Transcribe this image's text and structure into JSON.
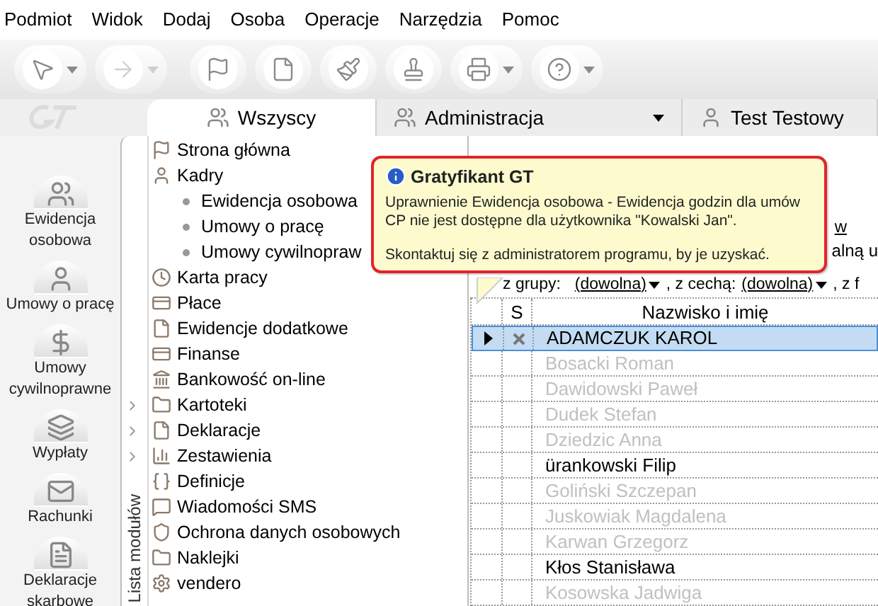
{
  "menu": [
    "Podmiot",
    "Widok",
    "Dodaj",
    "Osoba",
    "Operacje",
    "Narzędzia",
    "Pomoc"
  ],
  "toolbar": [
    {
      "kind": "arrow-left",
      "dropdown": true,
      "disabled": false
    },
    {
      "kind": "arrow-right",
      "dropdown": true,
      "disabled": true
    },
    {
      "kind": "flag",
      "dropdown": false,
      "disabled": false
    },
    {
      "kind": "sheet",
      "dropdown": false,
      "disabled": false
    },
    {
      "kind": "brush",
      "dropdown": false,
      "disabled": false
    },
    {
      "kind": "stamp",
      "dropdown": false,
      "disabled": false
    },
    {
      "kind": "printer",
      "dropdown": true,
      "disabled": false
    },
    {
      "kind": "help",
      "dropdown": true,
      "disabled": false
    }
  ],
  "tabs": [
    {
      "label": "Wszyscy",
      "kind": "group",
      "selected": true,
      "dropdown": false
    },
    {
      "label": "Administracja",
      "kind": "pair",
      "selected": false,
      "dropdown": true
    },
    {
      "label": "Test Testowy",
      "kind": "person",
      "selected": false,
      "dropdown": false
    }
  ],
  "shortcuts": [
    {
      "label": "Ewidencja osobowa",
      "kind": "people"
    },
    {
      "label": "Umowy o pracę",
      "kind": "contract"
    },
    {
      "label": "Umowy cywilnoprawne",
      "kind": "money"
    },
    {
      "label": "Wypłaty",
      "kind": "envelopes"
    },
    {
      "label": "Rachunki",
      "kind": "mail"
    },
    {
      "label": "Deklaracje skarbowe",
      "kind": "docs"
    }
  ],
  "modules_label": "Lista modułów",
  "modules": [
    {
      "label": "Strona główna",
      "kind": "flag",
      "arrow": false
    },
    {
      "label": "Kadry",
      "kind": "person",
      "arrow": false,
      "children": [
        {
          "label": "Ewidencja osobowa"
        },
        {
          "label": "Umowy o pracę"
        },
        {
          "label": "Umowy cywilnopraw"
        }
      ]
    },
    {
      "label": "Karta pracy",
      "kind": "clock",
      "arrow": false
    },
    {
      "label": "Płace",
      "kind": "cards",
      "arrow": false
    },
    {
      "label": "Ewidencje dodatkowe",
      "kind": "sheet",
      "arrow": false
    },
    {
      "label": "Finanse",
      "kind": "cards",
      "arrow": false
    },
    {
      "label": "Bankowość on-line",
      "kind": "bank",
      "arrow": false
    },
    {
      "label": "Kartoteki",
      "kind": "folder",
      "arrow": true
    },
    {
      "label": "Deklaracje",
      "kind": "sheet",
      "arrow": true
    },
    {
      "label": "Zestawienia",
      "kind": "chart",
      "arrow": true
    },
    {
      "label": "Definicje",
      "kind": "braces",
      "arrow": false
    },
    {
      "label": "Wiadomości SMS",
      "kind": "sms",
      "arrow": false
    },
    {
      "label": "Ochrona danych osobowych",
      "kind": "shield",
      "arrow": false
    },
    {
      "label": "Naklejki",
      "kind": "folder",
      "arrow": false
    },
    {
      "label": "vendero",
      "kind": "gear",
      "arrow": false
    }
  ],
  "content": {
    "link_fragment": "w",
    "text_fragment": "alną u",
    "filter": {
      "group_label": "z grupy:",
      "group_value": "(dowolna)",
      "trait_label": ", z cechą:",
      "trait_value": "(dowolna)",
      "more": ", z f"
    },
    "columns": [
      "S",
      "Nazwisko i imię"
    ],
    "rows": [
      {
        "name": "ADAMCZUK KAROL",
        "selected": true,
        "marked": true,
        "disabled": false
      },
      {
        "name": "Bosacki Roman",
        "selected": false,
        "marked": false,
        "disabled": true
      },
      {
        "name": "Dawidowski Paweł",
        "selected": false,
        "marked": false,
        "disabled": true
      },
      {
        "name": "Dudek Stefan",
        "selected": false,
        "marked": false,
        "disabled": true
      },
      {
        "name": "Dziedzic Anna",
        "selected": false,
        "marked": false,
        "disabled": true
      },
      {
        "name": "ürankowski Filip",
        "selected": false,
        "marked": false,
        "disabled": false
      },
      {
        "name": "Goliński Szczepan",
        "selected": false,
        "marked": false,
        "disabled": true
      },
      {
        "name": "Juskowiak Magdalena",
        "selected": false,
        "marked": false,
        "disabled": true
      },
      {
        "name": "Karwan Grzegorz",
        "selected": false,
        "marked": false,
        "disabled": true
      },
      {
        "name": "Kłos Stanisława",
        "selected": false,
        "marked": false,
        "disabled": false
      },
      {
        "name": "Kosowska Jadwiga",
        "selected": false,
        "marked": false,
        "disabled": true
      }
    ]
  },
  "tooltip": {
    "title": "Gratyfikant GT",
    "message": "Uprawnienie Ewidencja osobowa - Ewidencja godzin dla umów CP nie jest dostępne dla użytkownika \"Kowalski Jan\".",
    "hint": "Skontaktuj się z administratorem programu, by je uzyskać."
  }
}
